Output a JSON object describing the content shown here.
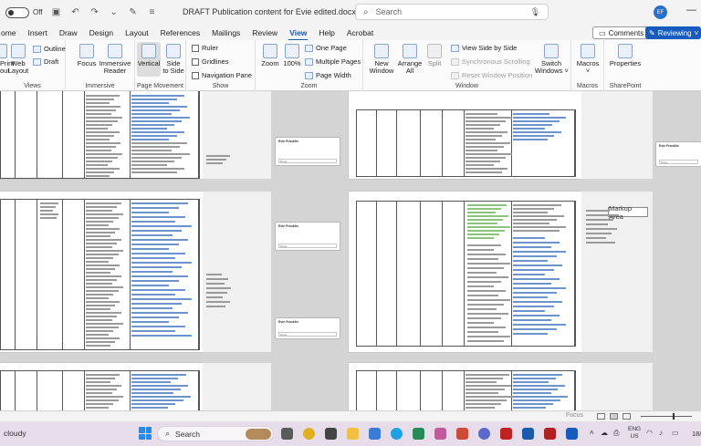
{
  "titlebar": {
    "autosave_state": "Off",
    "document_title": "DRAFT Publication content for Evie edited.docx • Saved",
    "search_placeholder": "Search",
    "user_initials": "EF",
    "minimize_glyph": "—"
  },
  "tabs": [
    {
      "label": "ome"
    },
    {
      "label": "Insert"
    },
    {
      "label": "Draw"
    },
    {
      "label": "Design"
    },
    {
      "label": "Layout"
    },
    {
      "label": "References"
    },
    {
      "label": "Mailings"
    },
    {
      "label": "Review"
    },
    {
      "label": "View",
      "active": true
    },
    {
      "label": "Help"
    },
    {
      "label": "Acrobat"
    }
  ],
  "header_buttons": {
    "comments": "Comments",
    "reviewing": "Reviewing"
  },
  "ribbon": {
    "views": {
      "label": "Views",
      "read_mode": "Read\nMode",
      "print_layout": "Print\nout",
      "web_layout": "Web\nLayout",
      "outline": "Outline",
      "draft": "Draft"
    },
    "immersive": {
      "label": "Immersive",
      "focus": "Focus",
      "immersive_reader": "Immersive\nReader"
    },
    "page_movement": {
      "label": "Page Movement",
      "vertical": "Vertical",
      "side_to_side": "Side\nto Side"
    },
    "show": {
      "label": "Show",
      "ruler": "Ruler",
      "gridlines": "Gridlines",
      "navigation_pane": "Navigation Pane"
    },
    "zoom": {
      "label": "Zoom",
      "zoom": "Zoom",
      "hundred": "100%",
      "one_page": "One Page",
      "multiple_pages": "Multiple Pages",
      "page_width": "Page Width"
    },
    "window": {
      "label": "Window",
      "new_window": "New\nWindow",
      "arrange_all": "Arrange\nAll",
      "split": "Split",
      "view_side_by_side": "View Side by Side",
      "synchronous_scrolling": "Synchronous Scrolling",
      "reset_window_position": "Reset Window Position",
      "switch_windows": "Switch\nWindows ˅"
    },
    "macros": {
      "label": "Macros",
      "macros": "Macros\n˅"
    },
    "sharepoint": {
      "label": "SharePoint",
      "properties": "Properties"
    }
  },
  "document": {
    "tooltip": "Markup Area",
    "comment_author": "Evie Franklin",
    "reply_placeholder": "Reply"
  },
  "statusbar": {
    "focus": "Focus"
  },
  "taskbar": {
    "weather": "cloudy",
    "search_placeholder": "Search",
    "language_top": "ENG",
    "language_bottom": "US",
    "clock": "18/"
  },
  "colors": {
    "accent": "#185abd",
    "taskbar": "#e6dcea"
  }
}
